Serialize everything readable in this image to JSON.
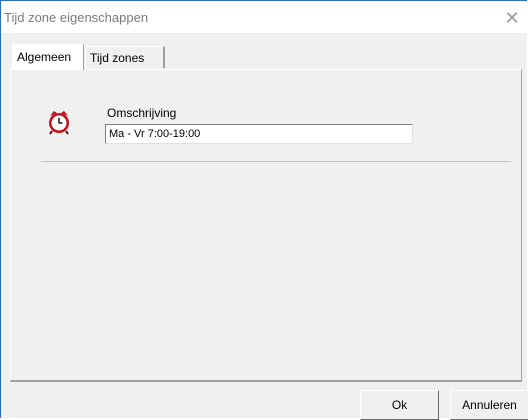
{
  "window": {
    "title": "Tijd zone eigenschappen",
    "close_glyph": "✕"
  },
  "tabs": [
    {
      "label": "Algemeen",
      "active": true
    },
    {
      "label": "Tijd zones",
      "active": false
    }
  ],
  "general": {
    "icon": "alarm-clock-icon",
    "description_label": "Omschrijving",
    "description_value": "Ma - Vr 7:00-19:00"
  },
  "buttons": {
    "ok_label": "Ok",
    "cancel_label": "Annuleren"
  },
  "colors": {
    "clock_red": "#c0101a",
    "window_border": "#2b6cc4"
  }
}
